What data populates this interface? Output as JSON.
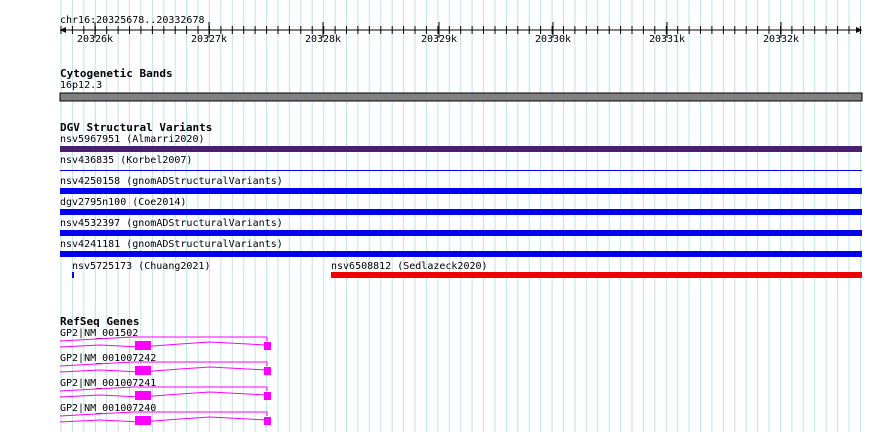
{
  "ruler": {
    "location": "chr16:20325678..20332678",
    "ticks": [
      "20326k",
      "20327k",
      "20328k",
      "20329k",
      "20330k",
      "20331k",
      "20332k"
    ]
  },
  "cytoband": {
    "title": "Cytogenetic Bands",
    "band": "16p12.3",
    "color": "#808080"
  },
  "dgv": {
    "title": "DGV Structural Variants",
    "items": [
      {
        "label": "nsv5967951 (Almarri2020)",
        "color": "#4b1f6f"
      },
      {
        "label": "nsv436835 (Korbel2007)",
        "color": "#0000ee"
      },
      {
        "label": "nsv4250158 (gnomADStructuralVariants)",
        "color": "#0000ee"
      },
      {
        "label": "dgv2795n100 (Coe2014)",
        "color": "#0000ee"
      },
      {
        "label": "nsv4532397 (gnomADStructuralVariants)",
        "color": "#0000ee"
      },
      {
        "label": "nsv4241181 (gnomADStructuralVariants)",
        "color": "#0000ee"
      },
      {
        "label": "nsv5725173 (Chuang2021)",
        "color": "#0000ee"
      },
      {
        "label": "nsv6508812 (Sedlazeck2020)",
        "color": "#ee0000"
      }
    ]
  },
  "refseq": {
    "title": "RefSeq Genes",
    "color": "#ff00ff",
    "genes": [
      "GP2|NM_001502",
      "GP2|NM_001007242",
      "GP2|NM_001007241",
      "GP2|NM_001007240"
    ]
  }
}
